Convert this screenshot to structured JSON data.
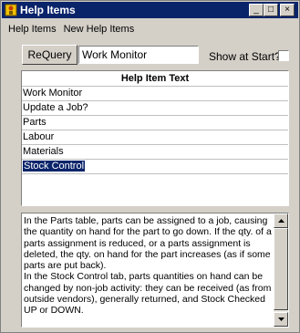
{
  "window": {
    "title": "Help Items",
    "controls": {
      "minimize": "_",
      "maximize": "□",
      "close": "×"
    }
  },
  "menu": [
    "Help Items",
    "New Help Items"
  ],
  "toolbar": {
    "requery_label": "ReQuery",
    "search_value": "Work Monitor",
    "show_at_start_label": "Show at Start?",
    "show_at_start_checked": false
  },
  "list": {
    "header": "Help Item Text",
    "items": [
      "Work Monitor",
      "Update a Job?",
      "Parts",
      "Labour",
      "Materials",
      "Stock Control"
    ],
    "selected_index": 5
  },
  "description": "In the Parts table, parts can be assigned to a job, causing the quantity on hand for the part to go down. If the qty. of a parts assignment is reduced, or a parts assignment is deleted, the qty. on hand for the part increases (as if some parts are put back).\nIn the Stock Control tab, parts quantities on hand can be changed by non-job activity: they can be received (as from outside vendors), generally returned, and Stock Checked UP or DOWN.",
  "icons": {
    "app": "app-icon",
    "scroll_up": "arrow-up-icon",
    "scroll_down": "arrow-down-icon"
  },
  "colors": {
    "titlebar": "#0a246a",
    "selection": "#0a246a",
    "face": "#d4d0c8"
  }
}
